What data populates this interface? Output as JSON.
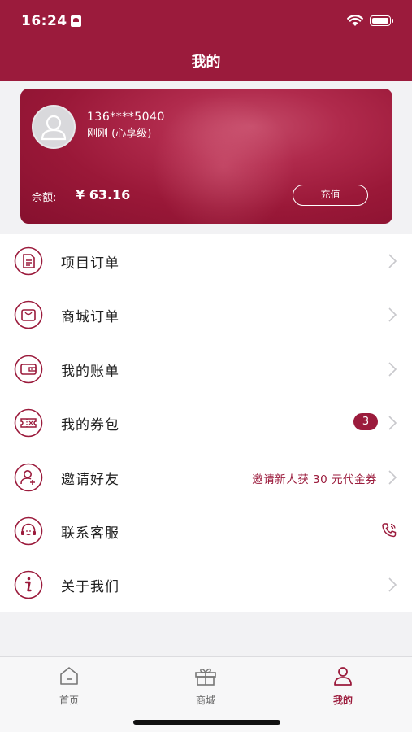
{
  "status_bar": {
    "time": "16:24"
  },
  "nav": {
    "title": "我的"
  },
  "profile": {
    "phone": "136****5040",
    "level": "刚刚 (心享级)",
    "balance_label": "余额:",
    "balance_value": "¥ 63.16",
    "recharge_label": "充值"
  },
  "menu": {
    "items": [
      {
        "label": "项目订单",
        "icon": "document-icon"
      },
      {
        "label": "商城订单",
        "icon": "shopping-bag-icon"
      },
      {
        "label": "我的账单",
        "icon": "wallet-icon"
      },
      {
        "label": "我的券包",
        "icon": "coupon-icon",
        "badge": "3"
      },
      {
        "label": "邀请好友",
        "icon": "add-user-icon",
        "promo": "邀请新人获 30 元代金券"
      },
      {
        "label": "联系客服",
        "icon": "customer-service-icon"
      },
      {
        "label": "关于我们",
        "icon": "info-icon"
      }
    ]
  },
  "tabbar": {
    "tabs": [
      {
        "label": "首页"
      },
      {
        "label": "商城"
      },
      {
        "label": "我的"
      }
    ]
  },
  "colors": {
    "accent": "#9b1b3c"
  }
}
